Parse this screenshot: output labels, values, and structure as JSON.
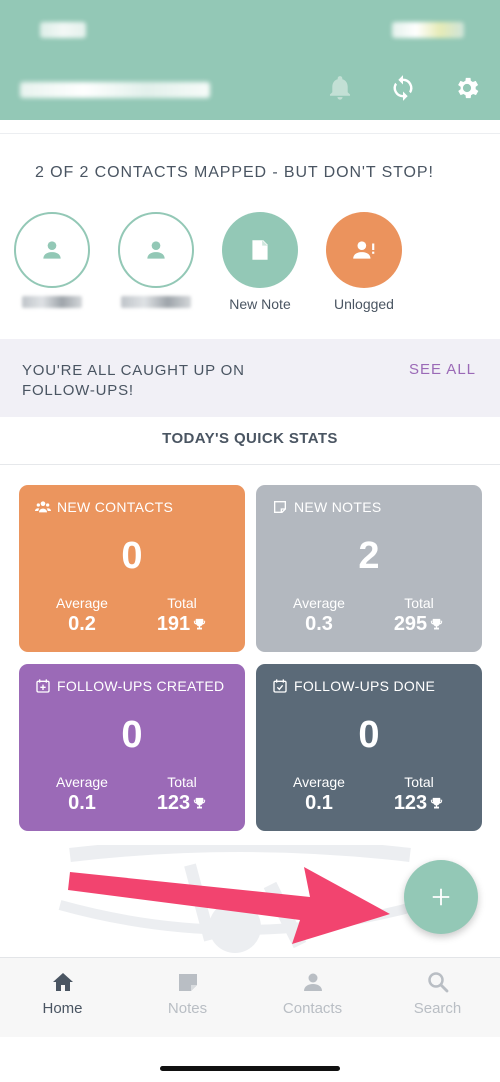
{
  "header": {
    "icons": [
      "bell-icon",
      "sync-icon",
      "gear-icon"
    ],
    "color": "#93c8b6"
  },
  "mapped": {
    "title": "2 OF 2 CONTACTS MAPPED - BUT DON'T STOP!",
    "actions": [
      {
        "label": "New Note",
        "icon": "note-icon"
      },
      {
        "label": "Unlogged",
        "icon": "person-alert-icon"
      }
    ]
  },
  "followups": {
    "message": "YOU'RE ALL CAUGHT UP ON FOLLOW-UPS!",
    "see_all": "SEE ALL"
  },
  "stats": {
    "title": "TODAY'S QUICK STATS",
    "average_label": "Average",
    "total_label": "Total",
    "cards": [
      {
        "title": "NEW CONTACTS",
        "value": "0",
        "average": "0.2",
        "total": "191",
        "color": "#eb955e",
        "icon": "group-icon"
      },
      {
        "title": "NEW NOTES",
        "value": "2",
        "average": "0.3",
        "total": "295",
        "color": "#b3b8bf",
        "icon": "note-outline-icon"
      },
      {
        "title": "FOLLOW-UPS CREATED",
        "value": "0",
        "average": "0.1",
        "total": "123",
        "color": "#9b6ab7",
        "icon": "calendar-plus-icon"
      },
      {
        "title": "FOLLOW-UPS DONE",
        "value": "0",
        "average": "0.1",
        "total": "123",
        "color": "#5b6a78",
        "icon": "calendar-check-icon"
      }
    ]
  },
  "nav": {
    "items": [
      {
        "label": "Home",
        "icon": "home-icon",
        "active": true
      },
      {
        "label": "Notes",
        "icon": "notes-icon",
        "active": false
      },
      {
        "label": "Contacts",
        "icon": "contact-icon",
        "active": false
      },
      {
        "label": "Search",
        "icon": "search-icon",
        "active": false
      }
    ]
  },
  "colors": {
    "accent": "#93c8b6",
    "purple": "#9b6ab7",
    "arrow": "#f2446f"
  }
}
